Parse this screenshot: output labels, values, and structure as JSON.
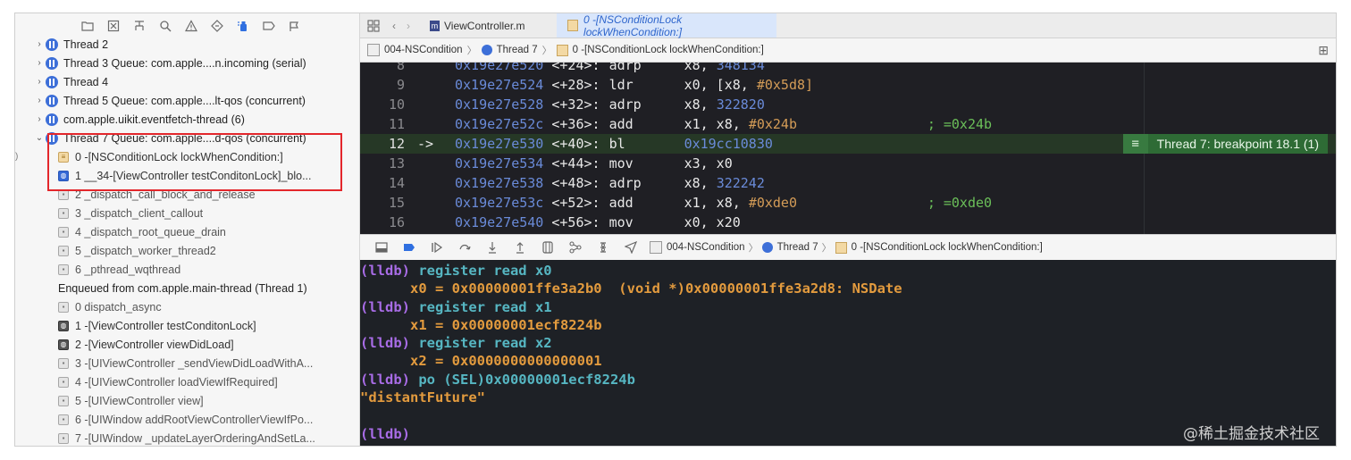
{
  "navigator": {
    "threads": [
      {
        "label": "Thread 2"
      },
      {
        "label": "Thread 3 Queue: com.apple....n.incoming (serial)"
      },
      {
        "label": "Thread 4"
      },
      {
        "label": "Thread 5 Queue: com.apple....lt-qos (concurrent)"
      },
      {
        "label": "com.apple.uikit.eventfetch-thread (6)"
      },
      {
        "label": "Thread 7 Queue: com.apple....d-qos (concurrent)"
      }
    ],
    "frames": [
      {
        "label": "0 -[NSConditionLock lockWhenCondition:]"
      },
      {
        "label": "1 __34-[ViewController testConditonLock]_blo..."
      },
      {
        "label": "2 _dispatch_call_block_and_release"
      },
      {
        "label": "3 _dispatch_client_callout"
      },
      {
        "label": "4 _dispatch_root_queue_drain"
      },
      {
        "label": "5 _dispatch_worker_thread2"
      },
      {
        "label": "6 _pthread_wqthread"
      }
    ],
    "enqueued_label": "Enqueued from com.apple.main-thread (Thread 1)",
    "enqueued_frames": [
      {
        "label": "0 dispatch_async"
      },
      {
        "label": "1 -[ViewController testConditonLock]"
      },
      {
        "label": "2 -[ViewController viewDidLoad]"
      },
      {
        "label": "3 -[UIViewController _sendViewDidLoadWithA..."
      },
      {
        "label": "4 -[UIViewController loadViewIfRequired]"
      },
      {
        "label": "5 -[UIViewController view]"
      },
      {
        "label": "6 -[UIWindow addRootViewControllerViewIfPo..."
      },
      {
        "label": "7 -[UIWindow _updateLayerOrderingAndSetLa..."
      }
    ]
  },
  "tabs": [
    {
      "label": "ViewController.m"
    },
    {
      "label": "0 -[NSConditionLock lockWhenCondition:]"
    }
  ],
  "jumpbar": {
    "project": "004-NSCondition",
    "thread": "Thread 7",
    "frame": "0 -[NSConditionLock lockWhenCondition:]"
  },
  "code_lines": [
    {
      "num": "8",
      "arrow": "",
      "addr": "0x19e27e520",
      "off": " <+24>:",
      "mn": "adrp",
      "ops": "x8, ",
      "num_op": "348134",
      "imm": "",
      "cmt": ""
    },
    {
      "num": "9",
      "arrow": "",
      "addr": "0x19e27e524",
      "off": " <+28>:",
      "mn": "ldr",
      "ops": "x0, [x8, ",
      "num_op": "",
      "imm": "#0x5d8]",
      "cmt": ""
    },
    {
      "num": "10",
      "arrow": "",
      "addr": "0x19e27e528",
      "off": " <+32>:",
      "mn": "adrp",
      "ops": "x8, ",
      "num_op": "322820",
      "imm": "",
      "cmt": ""
    },
    {
      "num": "11",
      "arrow": "",
      "addr": "0x19e27e52c",
      "off": " <+36>:",
      "mn": "add",
      "ops": "x1, x8, ",
      "num_op": "",
      "imm": "#0x24b",
      "cmt": "; =0x24b"
    },
    {
      "num": "12",
      "arrow": "->",
      "addr": "0x19e27e530",
      "off": " <+40>:",
      "mn": "bl",
      "ops": "",
      "num_op": "0x19cc10830",
      "imm": "",
      "cmt": ""
    },
    {
      "num": "13",
      "arrow": "",
      "addr": "0x19e27e534",
      "off": " <+44>:",
      "mn": "mov",
      "ops": "x3, x0",
      "num_op": "",
      "imm": "",
      "cmt": ""
    },
    {
      "num": "14",
      "arrow": "",
      "addr": "0x19e27e538",
      "off": " <+48>:",
      "mn": "adrp",
      "ops": "x8, ",
      "num_op": "322242",
      "imm": "",
      "cmt": ""
    },
    {
      "num": "15",
      "arrow": "",
      "addr": "0x19e27e53c",
      "off": " <+52>:",
      "mn": "add",
      "ops": "x1, x8, ",
      "num_op": "",
      "imm": "#0xde0",
      "cmt": "; =0xde0"
    },
    {
      "num": "16",
      "arrow": "",
      "addr": "0x19e27e540",
      "off": " <+56>:",
      "mn": "mov",
      "ops": "x0, x20",
      "num_op": "",
      "imm": "",
      "cmt": ""
    }
  ],
  "breakpoint_label": "Thread 7: breakpoint 18.1 (1)",
  "debugbar": {
    "project": "004-NSCondition",
    "thread": "Thread 7",
    "frame": "0 -[NSConditionLock lockWhenCondition:]"
  },
  "console": [
    {
      "prompt": "(lldb) ",
      "cmd": "register read x0",
      "out": ""
    },
    {
      "prompt": "",
      "cmd": "",
      "out": "      x0 = 0x00000001ffe3a2b0  (void *)0x00000001ffe3a2d8: NSDate"
    },
    {
      "prompt": "(lldb) ",
      "cmd": "register read x1",
      "out": ""
    },
    {
      "prompt": "",
      "cmd": "",
      "out": "      x1 = 0x00000001ecf8224b"
    },
    {
      "prompt": "(lldb) ",
      "cmd": "register read x2",
      "out": ""
    },
    {
      "prompt": "",
      "cmd": "",
      "out": "      x2 = 0x0000000000000001"
    },
    {
      "prompt": "(lldb) ",
      "cmd": "po (SEL)0x00000001ecf8224b",
      "out": ""
    },
    {
      "prompt": "",
      "cmd": "",
      "out": "\"distantFuture\""
    },
    {
      "prompt": "",
      "cmd": "",
      "out": ""
    },
    {
      "prompt": "(lldb)",
      "cmd": "",
      "out": ""
    }
  ],
  "watermark": "@稀土掘金技术社区",
  "colors": {
    "highlight_box": "#e3262b",
    "breakpoint_green": "#2e6b35",
    "accent_blue": "#2f6fe0"
  }
}
